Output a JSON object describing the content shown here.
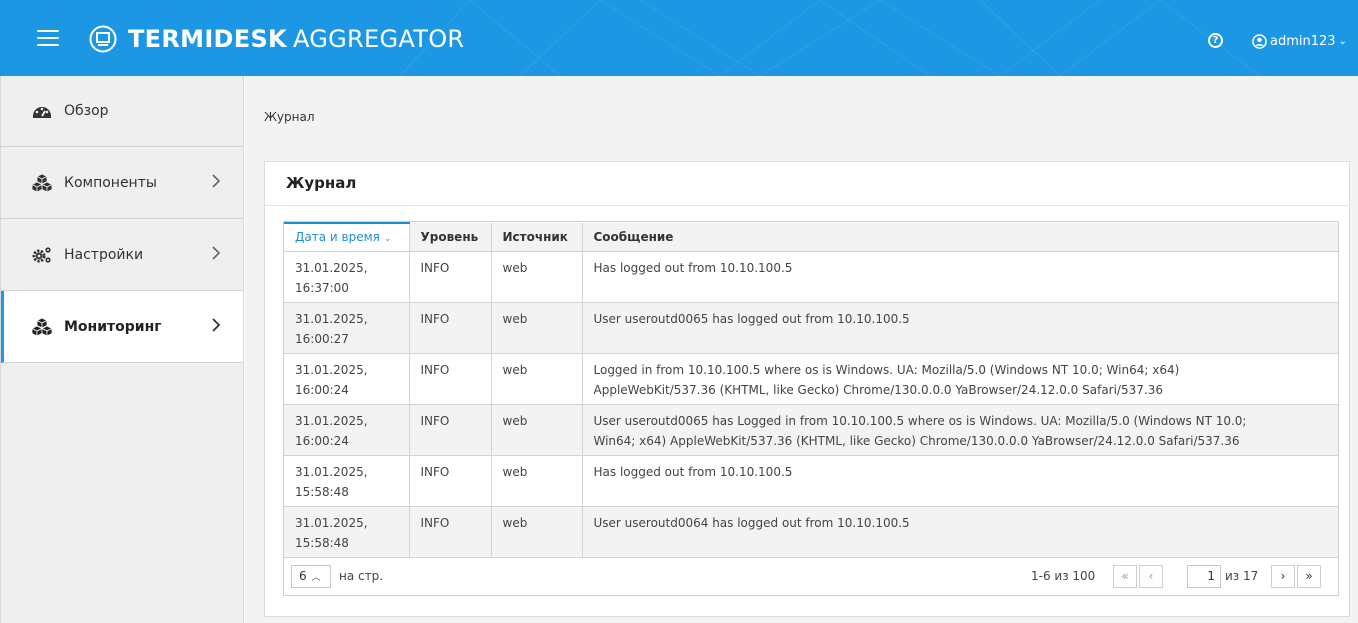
{
  "header": {
    "brand_bold": "TERMIDESK",
    "brand_light": "AGGREGATOR",
    "help_glyph": "?",
    "username": "admin123",
    "accent_color": "#1b97e3"
  },
  "sidebar": {
    "items": [
      {
        "label": "Обзор",
        "icon": "dashboard-icon"
      },
      {
        "label": "Компоненты",
        "icon": "cubes-icon"
      },
      {
        "label": "Настройки",
        "icon": "gears-icon"
      },
      {
        "label": "Мониторинг",
        "icon": "cubes-icon",
        "active": true
      }
    ]
  },
  "main": {
    "breadcrumb": "Журнал",
    "card_title": "Журнал",
    "columns": [
      "Дата и время",
      "Уровень",
      "Источник",
      "Сообщение"
    ],
    "sorted_column": "Дата и время",
    "rows": [
      {
        "date": "31.01.2025,",
        "time": "16:37:00",
        "level": "INFO",
        "source": "web",
        "message": "Has logged out from 10.10.100.5",
        "message2": ""
      },
      {
        "date": "31.01.2025,",
        "time": "16:00:27",
        "level": "INFO",
        "source": "web",
        "message": "User useroutd0065 has logged out from 10.10.100.5",
        "message2": ""
      },
      {
        "date": "31.01.2025,",
        "time": "16:00:24",
        "level": "INFO",
        "source": "web",
        "message": "Logged in from 10.10.100.5 where os is Windows. UA: Mozilla/5.0 (Windows NT 10.0; Win64; x64)",
        "message2": "AppleWebKit/537.36 (KHTML, like Gecko) Chrome/130.0.0.0 YaBrowser/24.12.0.0 Safari/537.36"
      },
      {
        "date": "31.01.2025,",
        "time": "16:00:24",
        "level": "INFO",
        "source": "web",
        "message": "User useroutd0065 has Logged in from 10.10.100.5 where os is Windows. UA: Mozilla/5.0 (Windows NT 10.0;",
        "message2": "Win64; x64) AppleWebKit/537.36 (KHTML, like Gecko) Chrome/130.0.0.0 YaBrowser/24.12.0.0 Safari/537.36"
      },
      {
        "date": "31.01.2025,",
        "time": "15:58:48",
        "level": "INFO",
        "source": "web",
        "message": "Has logged out from 10.10.100.5",
        "message2": ""
      },
      {
        "date": "31.01.2025,",
        "time": "15:58:48",
        "level": "INFO",
        "source": "web",
        "message": "User useroutd0064 has logged out from 10.10.100.5",
        "message2": ""
      }
    ],
    "pager": {
      "per_page": "6",
      "per_page_label": "на стр.",
      "range": "1-6 из 100",
      "first": "«",
      "prev": "‹",
      "page": "1",
      "of_pages": "из 17",
      "next": "›",
      "last": "»"
    }
  }
}
